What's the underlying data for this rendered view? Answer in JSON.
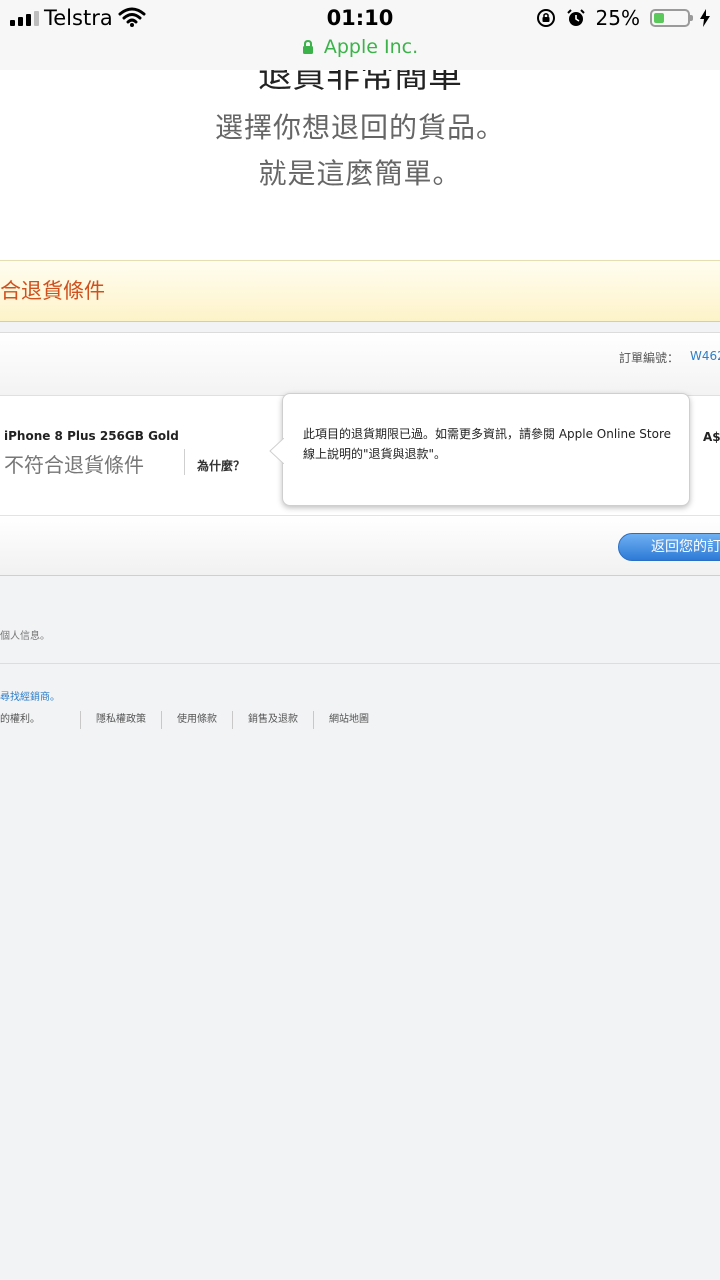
{
  "status_bar": {
    "carrier": "Telstra",
    "time": "01:10",
    "battery_percent": "25%",
    "battery_level": 0.25,
    "site_name": "Apple Inc.",
    "colors": {
      "secure": "#3cb34a",
      "battery_fill": "#5ac85a"
    },
    "icons": [
      "signal-icon",
      "wifi-icon",
      "lock-icon",
      "rotation-lock-icon",
      "alarm-icon",
      "battery-icon",
      "charging-icon"
    ]
  },
  "hero": {
    "title_cut": "退貨非常簡單",
    "line1": "選擇你想退回的貨品。",
    "line2": "就是這麼簡單。"
  },
  "banner": {
    "text": "合退貨條件",
    "color": "#d0501e"
  },
  "order": {
    "number_label": "訂單編號：",
    "number_value": "W462",
    "product_name": "iPhone 8 Plus 256GB Gold",
    "status": "不符合退貨條件",
    "why_label": "為什麼？",
    "price": "A$",
    "return_button": "返回您的訂"
  },
  "tooltip": {
    "text": "此項目的退貨期限已過。如需更多資訊，請參閱 Apple Online Store 線上說明的\"退貨與退款\"。"
  },
  "footer": {
    "privacy_text": "個人信息。",
    "reseller_link": "尋找經銷商。",
    "rights": "的權利。",
    "links": [
      "隱私權政策",
      "使用條款",
      "銷售及退款",
      "網站地圖"
    ]
  },
  "accent_color": "#2e7ec8"
}
